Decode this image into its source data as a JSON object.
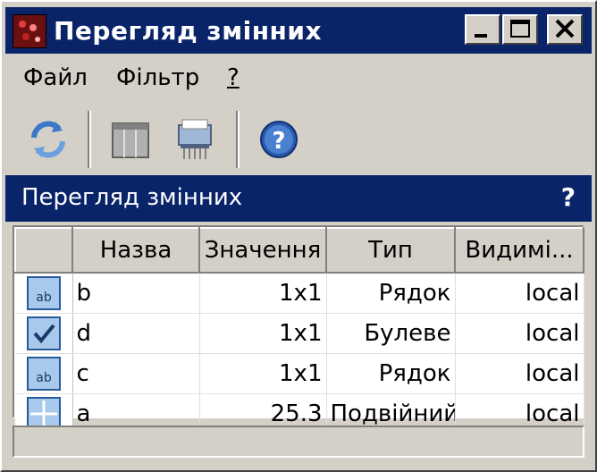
{
  "window": {
    "title": "Перегляд змінних",
    "controls": [
      "_",
      "□",
      "X"
    ]
  },
  "menu": [
    {
      "label": "Файл"
    },
    {
      "label": "Фільтр"
    },
    {
      "label": "?"
    }
  ],
  "toolbar": {
    "buttons": [
      {
        "icon": "refresh-icon"
      },
      {
        "icon": "columns-icon"
      },
      {
        "icon": "delete-shredder-icon"
      },
      {
        "icon": "help-icon"
      }
    ]
  },
  "panel": {
    "title": "Перегляд змінних",
    "help": "?"
  },
  "table": {
    "columns": [
      "",
      "Назва",
      "Значення",
      "Тип",
      "Видимі..."
    ],
    "rows": [
      {
        "icon": "text-type-icon",
        "name": "b",
        "value": "1x1",
        "type": "Рядок",
        "visibility": "local"
      },
      {
        "icon": "boolean-type-icon",
        "name": "d",
        "value": "1x1",
        "type": "Булеве",
        "visibility": "local"
      },
      {
        "icon": "text-type-icon",
        "name": "c",
        "value": "1x1",
        "type": "Рядок",
        "visibility": "local"
      },
      {
        "icon": "double-type-icon",
        "name": "a",
        "value": "25.3",
        "type": "Подвійний",
        "visibility": "local"
      }
    ]
  },
  "colors": {
    "titlebar": "#0a246a",
    "face": "#d4d0c8",
    "icon_fill": "#a8c8ec"
  }
}
